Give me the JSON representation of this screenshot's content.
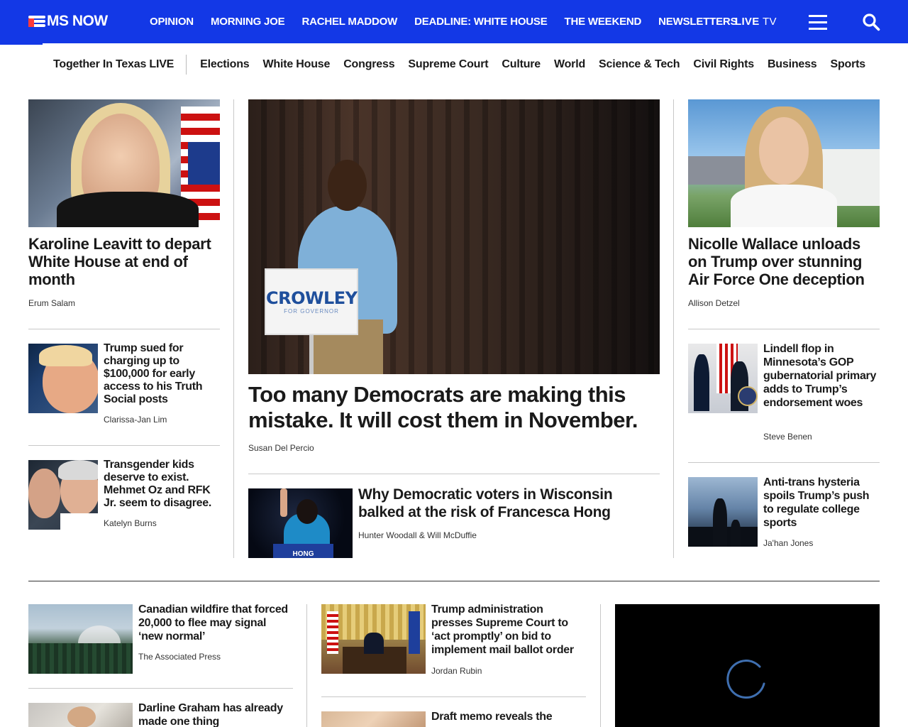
{
  "brand": {
    "name": "MS NOW",
    "accent": "#1338e6"
  },
  "topnav": {
    "items": [
      "OPINION",
      "MORNING JOE",
      "RACHEL MADDOW",
      "DEADLINE: WHITE HOUSE",
      "THE WEEKEND",
      "NEWSLETTERS"
    ],
    "live_a": "LIVE",
    "live_b": "TV"
  },
  "subnav": {
    "featured": "Together In Texas LIVE",
    "items": [
      "Elections",
      "White House",
      "Congress",
      "Supreme Court",
      "Culture",
      "World",
      "Science & Tech",
      "Civil Rights",
      "Business",
      "Sports"
    ]
  },
  "left_col": {
    "lead": {
      "headline": "Karoline Leavitt to depart White House at end of month",
      "byline": "Erum Salam"
    },
    "stories": [
      {
        "headline": "Trump sued for charging up to $100,000 for early access to his Truth Social posts",
        "byline": "Clarissa-Jan Lim"
      },
      {
        "headline": "Transgender kids deserve to exist. Mehmet Oz and RFK Jr. seem to disagree.",
        "byline": "Katelyn Burns"
      }
    ]
  },
  "center_col": {
    "lead": {
      "headline": "Too many Democrats are making this mistake. It will cost them in November.",
      "byline": "Susan Del Percio",
      "sign_text": "CROWLEY",
      "sign_sub": "FOR GOVERNOR"
    },
    "story": {
      "headline": "Why Democratic voters in Wisconsin balked at the risk of Francesca Hong",
      "byline": "Hunter Woodall & Will McDuffie",
      "podium_text": "HONG"
    }
  },
  "right_col": {
    "lead": {
      "headline": "Nicolle Wallace unloads on Trump over stunning Air Force One deception",
      "byline": "Allison Detzel"
    },
    "stories": [
      {
        "headline": "Lindell flop in Minnesota’s GOP gubernatorial primary adds to Trump’s endorsement woes",
        "byline": "Steve Benen"
      },
      {
        "headline": "Anti-trans hysteria spoils Trump’s push to regulate college sports",
        "byline": "Ja'han Jones"
      }
    ]
  },
  "bottom_row": {
    "col1": [
      {
        "headline": "Canadian wildfire that forced 20,000 to flee may signal ‘new normal’",
        "byline": "The Associated Press"
      },
      {
        "headline": "Darline Graham has already made one thing"
      }
    ],
    "col2": [
      {
        "headline": "Trump administration presses Supreme Court to ‘act promptly’ on bid to implement mail ballot order",
        "byline": "Jordan Rubin"
      },
      {
        "headline": "Draft memo reveals the"
      }
    ]
  }
}
